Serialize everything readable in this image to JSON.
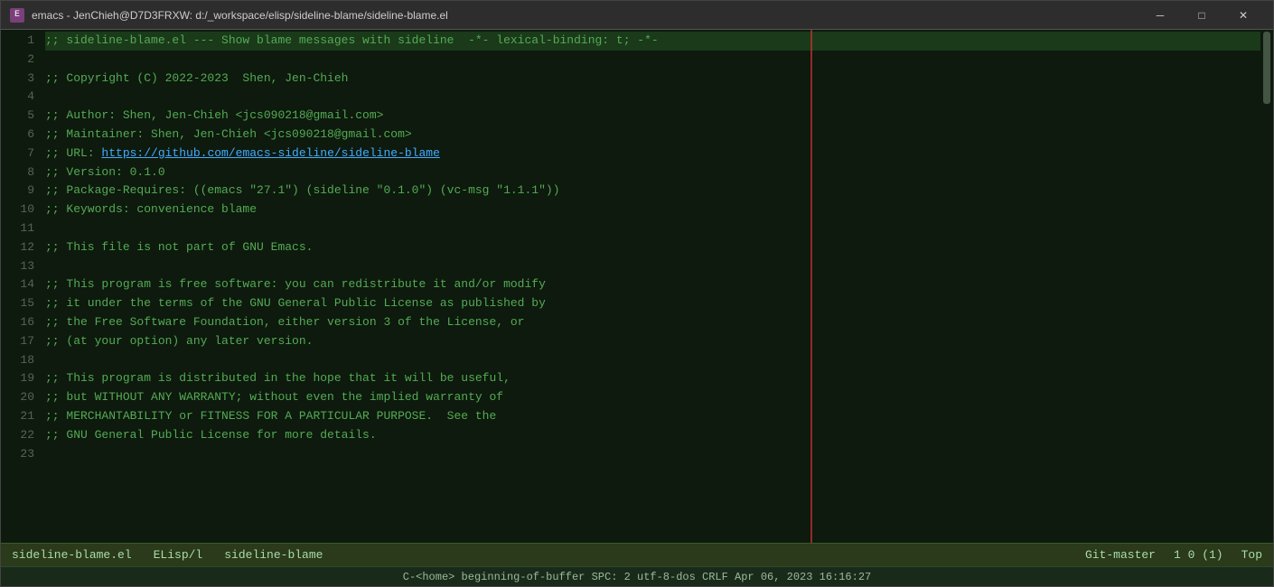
{
  "titleBar": {
    "icon": "E",
    "title": "emacs - JenChieh@D7D3FRXW: d:/_workspace/elisp/sideline-blame/sideline-blame.el",
    "minimizeLabel": "─",
    "maximizeLabel": "□",
    "closeLabel": "✕"
  },
  "codeLines": [
    {
      "num": "1",
      "content": ";; sideline-blame.el --- Show blame messages with sideline  -*- lexical-binding: t; -*-",
      "type": "comment",
      "highlight": true
    },
    {
      "num": "2",
      "content": "",
      "type": "default"
    },
    {
      "num": "3",
      "content": ";; Copyright (C) 2022-2023  Shen, Jen-Chieh",
      "type": "comment"
    },
    {
      "num": "4",
      "content": "",
      "type": "default"
    },
    {
      "num": "5",
      "content": ";; Author: Shen, Jen-Chieh <jcs090218@gmail.com>",
      "type": "comment"
    },
    {
      "num": "6",
      "content": ";; Maintainer: Shen, Jen-Chieh <jcs090218@gmail.com>",
      "type": "comment"
    },
    {
      "num": "7",
      "content": ";; URL: ",
      "type": "comment",
      "link": "https://github.com/emacs-sideline/sideline-blame",
      "linkText": "https://github.com/emacs-sideline/sideline-blame"
    },
    {
      "num": "8",
      "content": ";; Version: 0.1.0",
      "type": "comment"
    },
    {
      "num": "9",
      "content": ";; Package-Requires: ((emacs \"27.1\") (sideline \"0.1.0\") (vc-msg \"1.1.1\"))",
      "type": "comment"
    },
    {
      "num": "10",
      "content": ";; Keywords: convenience blame",
      "type": "comment"
    },
    {
      "num": "11",
      "content": "",
      "type": "default"
    },
    {
      "num": "12",
      "content": ";; This file is not part of GNU Emacs.",
      "type": "comment"
    },
    {
      "num": "13",
      "content": "",
      "type": "default"
    },
    {
      "num": "14",
      "content": ";; This program is free software: you can redistribute it and/or modify",
      "type": "comment"
    },
    {
      "num": "15",
      "content": ";; it under the terms of the GNU General Public License as published by",
      "type": "comment"
    },
    {
      "num": "16",
      "content": ";; the Free Software Foundation, either version 3 of the License, or",
      "type": "comment"
    },
    {
      "num": "17",
      "content": ";; (at your option) any later version.",
      "type": "comment"
    },
    {
      "num": "18",
      "content": "",
      "type": "default"
    },
    {
      "num": "19",
      "content": ";; This program is distributed in the hope that it will be useful,",
      "type": "comment"
    },
    {
      "num": "20",
      "content": ";; but WITHOUT ANY WARRANTY; without even the implied warranty of",
      "type": "comment"
    },
    {
      "num": "21",
      "content": ";; MERCHANTABILITY or FITNESS FOR A PARTICULAR PURPOSE.  See the",
      "type": "comment"
    },
    {
      "num": "22",
      "content": ";; GNU General Public License for more details.",
      "type": "comment"
    },
    {
      "num": "23",
      "content": "",
      "type": "default"
    }
  ],
  "statusBar1": {
    "filename": "sideline-blame.el",
    "mode": "ELisp/l",
    "project": "sideline-blame",
    "branch": "Git-master",
    "position": "1 0 (1)",
    "top": "Top"
  },
  "statusBar2": {
    "content": "C-<home> beginning-of-buffer     SPC: 2  utf-8-dos  CRLF  Apr 06, 2023  16:16:27"
  }
}
